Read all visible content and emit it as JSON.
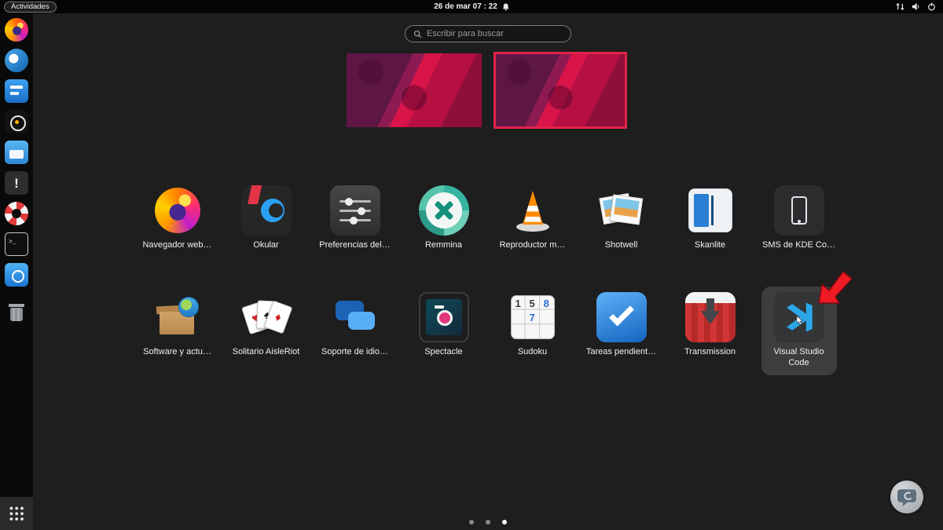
{
  "topbar": {
    "activities_label": "Actividades",
    "clock": "26 de mar 07 : 22"
  },
  "search": {
    "placeholder": "Escribir para buscar"
  },
  "workspaces": {
    "count": 2,
    "active_index": 1
  },
  "dock": {
    "items": [
      "firefox",
      "email",
      "documents",
      "camera",
      "files",
      "warning",
      "help",
      "terminal",
      "screenshot",
      "trash",
      "show-applications"
    ]
  },
  "apps": {
    "items": [
      {
        "label": "Navegador web…",
        "icon": "firefox"
      },
      {
        "label": "Okular",
        "icon": "okular"
      },
      {
        "label": "Preferencias del…",
        "icon": "settings"
      },
      {
        "label": "Remmina",
        "icon": "remmina"
      },
      {
        "label": "Reproductor m…",
        "icon": "vlc"
      },
      {
        "label": "Shotwell",
        "icon": "shotwell"
      },
      {
        "label": "Skanlite",
        "icon": "skanlite"
      },
      {
        "label": "SMS de KDE Co…",
        "icon": "kde-connect-sms"
      },
      {
        "label": "Software y actu…",
        "icon": "software-updates"
      },
      {
        "label": "Solitario AisleRiot",
        "icon": "aisleriot"
      },
      {
        "label": "Soporte de idio…",
        "icon": "language-support"
      },
      {
        "label": "Spectacle",
        "icon": "spectacle"
      },
      {
        "label": "Sudoku",
        "icon": "sudoku"
      },
      {
        "label": "Tareas pendient…",
        "icon": "todo"
      },
      {
        "label": "Transmission",
        "icon": "transmission"
      },
      {
        "label": "Visual Studio Code",
        "icon": "vscode",
        "selected": true
      }
    ],
    "sudoku_digits": [
      "1",
      "5",
      "8",
      "7"
    ]
  },
  "glyphs": {
    "warning": "!",
    "terminal_prompt": ">_",
    "heart": "♥",
    "spade": "♠",
    "diamond": "♦"
  },
  "pager": {
    "pages": 3,
    "active_index": 2
  },
  "annotation": {
    "type": "red-arrow",
    "points_to": "Visual Studio Code"
  },
  "colors": {
    "background": "#1e1e1e",
    "topbar": "#050505",
    "selection_bg": "#3d3d3d",
    "active_workspace_border": "#e0234a",
    "arrow_red": "#ee1b24"
  }
}
